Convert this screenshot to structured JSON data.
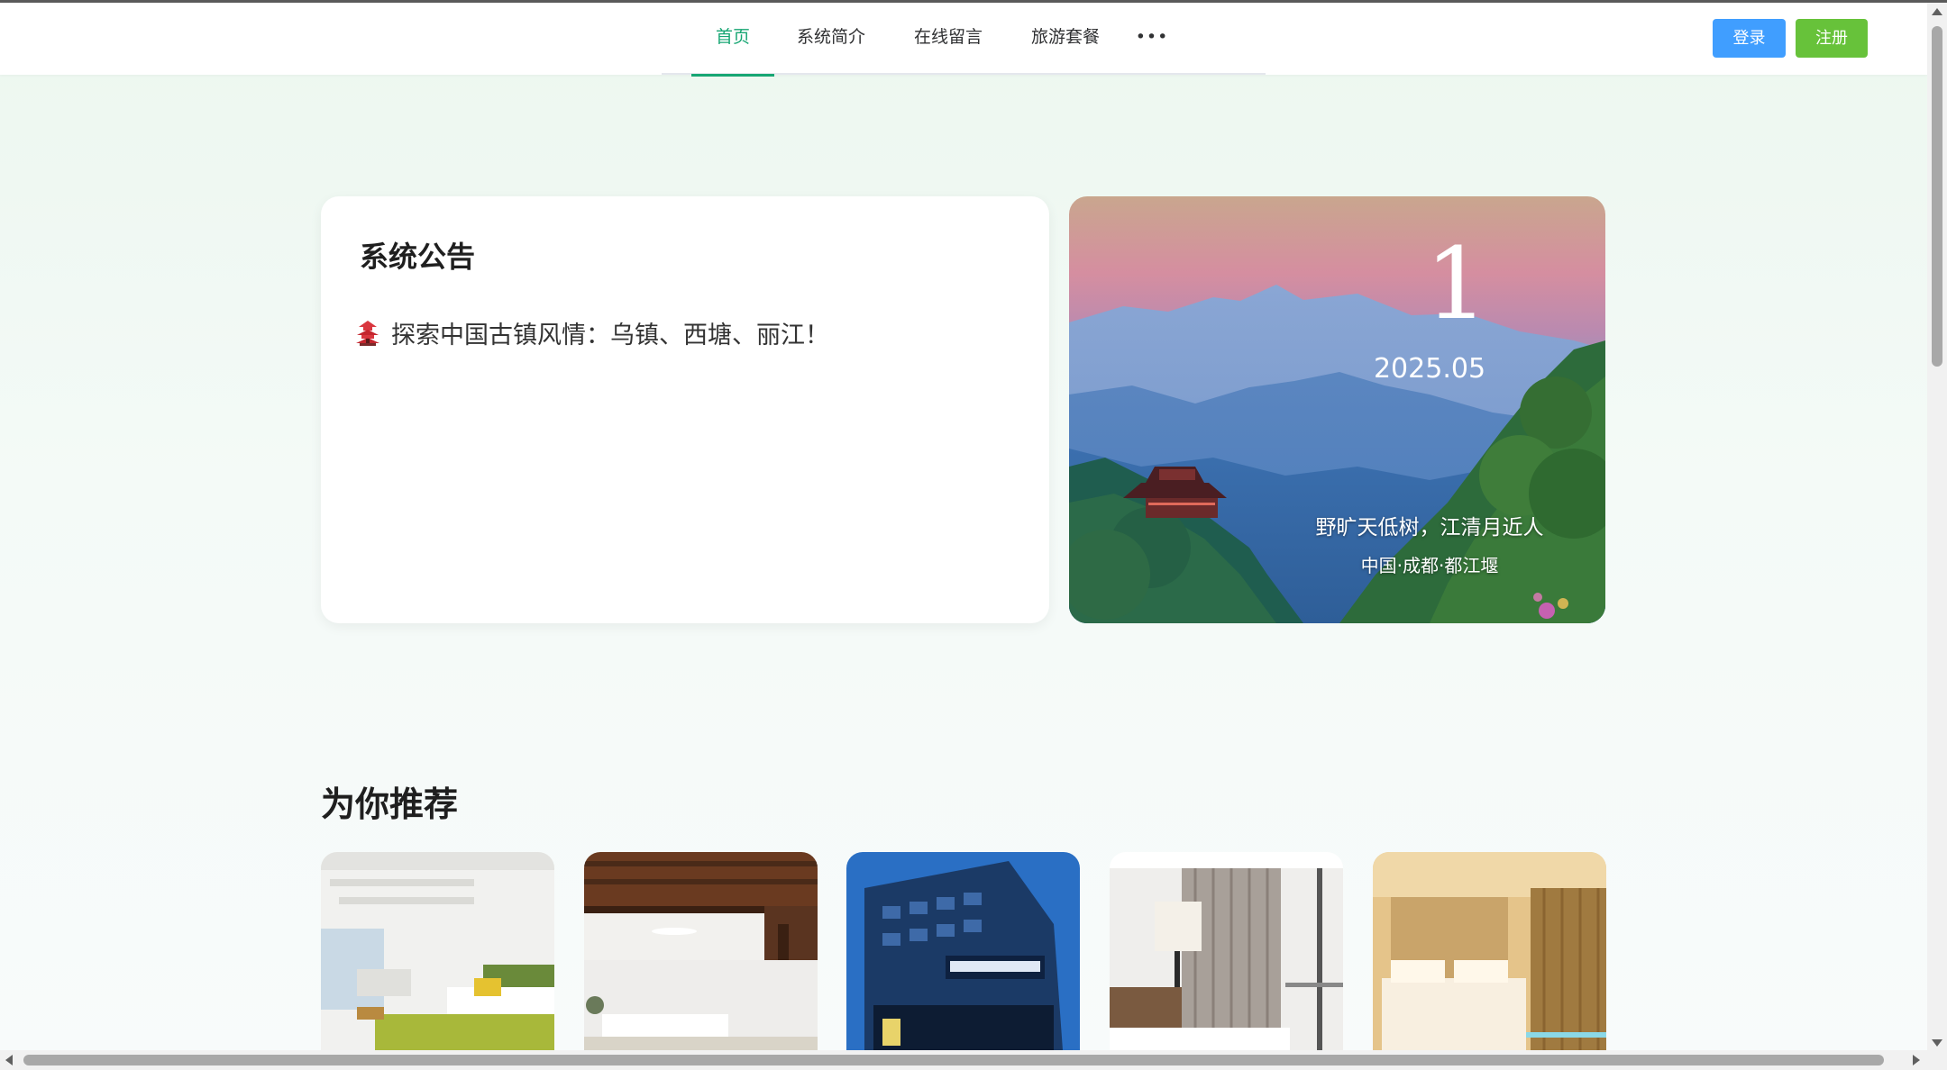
{
  "nav": {
    "items": [
      {
        "label": "首页",
        "active": true
      },
      {
        "label": "系统简介",
        "active": false
      },
      {
        "label": "在线留言",
        "active": false
      },
      {
        "label": "旅游套餐",
        "active": false
      },
      {
        "label": "•••",
        "active": false
      }
    ],
    "active_color": "#17a673"
  },
  "auth": {
    "login_label": "登录",
    "register_label": "注册",
    "login_color": "#409eff",
    "register_color": "#67c23a"
  },
  "notice": {
    "title": "系统公告",
    "items": [
      {
        "icon": "pagoda-icon",
        "text": "探索中国古镇风情：乌镇、西塘、丽江！"
      }
    ]
  },
  "scenic": {
    "day": "1",
    "date": "2025.05",
    "poem": "野旷天低树，江清月近人",
    "location": "中国·成都·都江堰"
  },
  "recommend": {
    "title": "为你推荐",
    "cards": [
      {
        "image": "bright-bedroom-photo"
      },
      {
        "image": "hotel-lobby-photo"
      },
      {
        "image": "hotel-building-photo"
      },
      {
        "image": "hotel-room-lamp-photo"
      },
      {
        "image": "warm-hotel-room-photo"
      }
    ]
  }
}
